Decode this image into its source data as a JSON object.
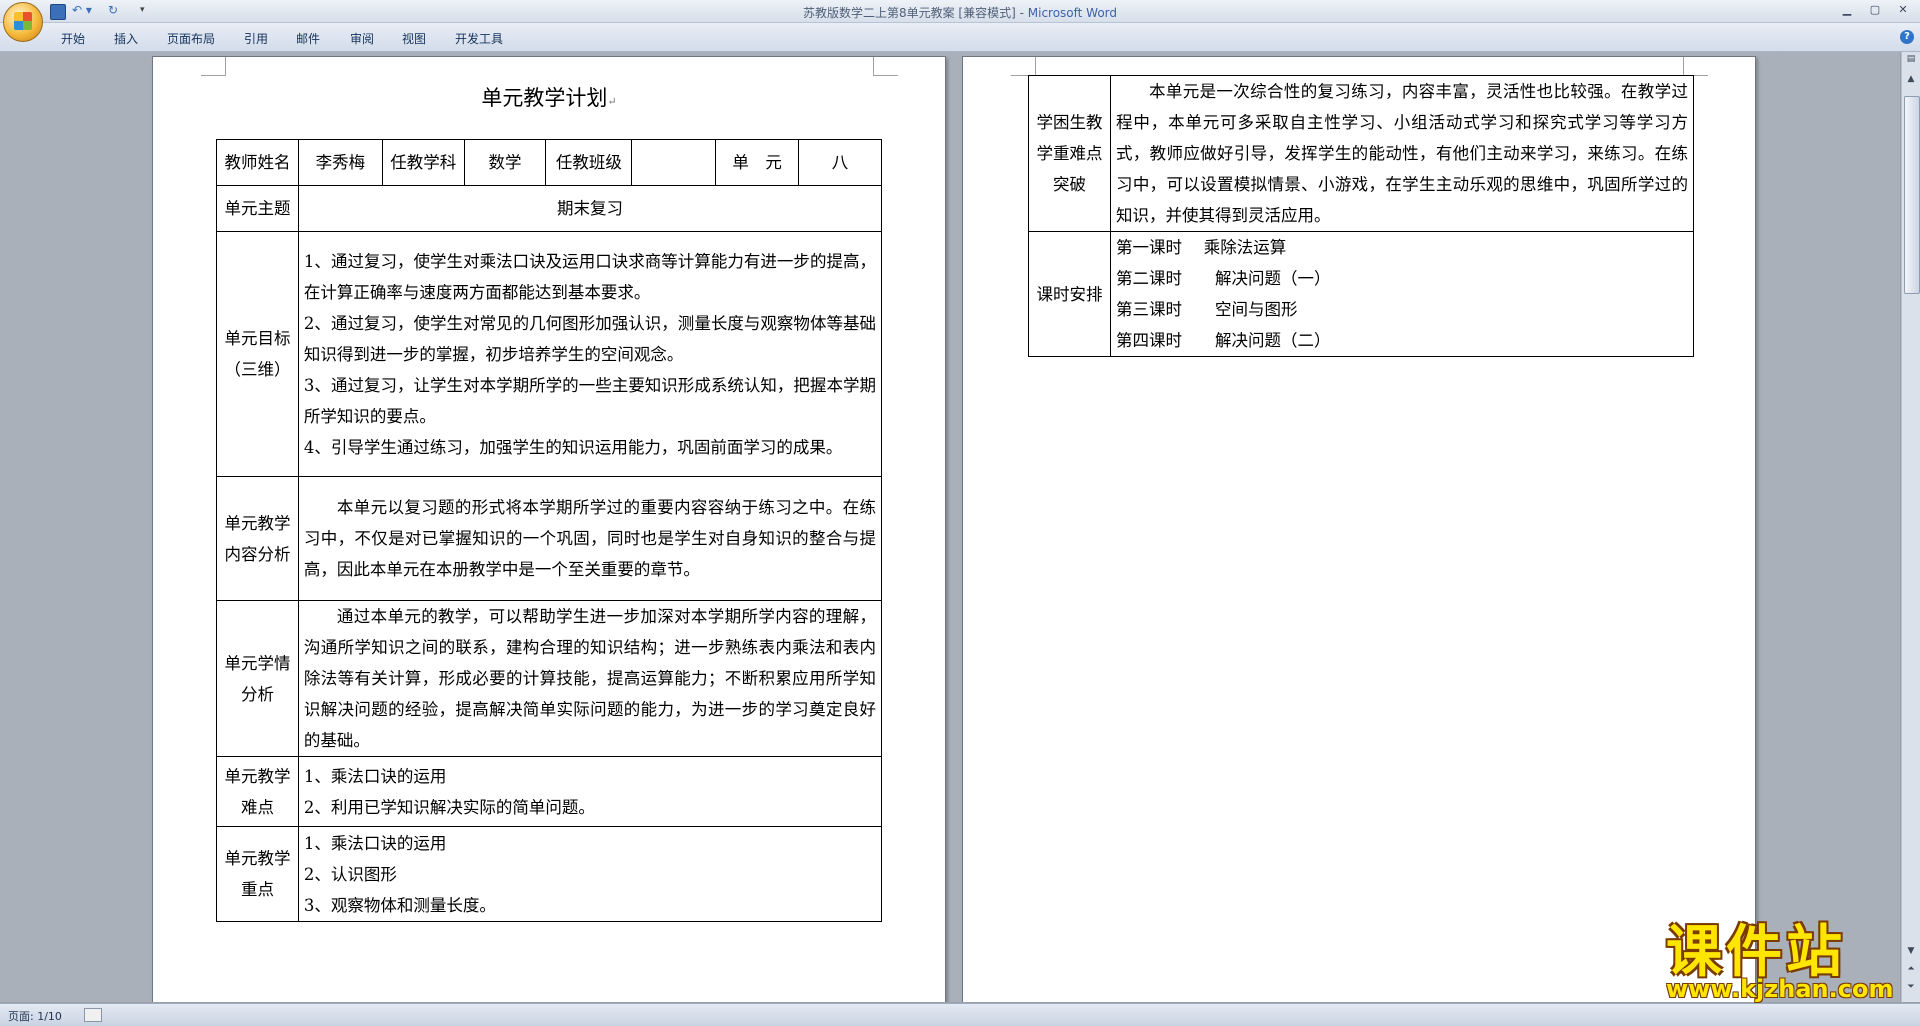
{
  "window": {
    "doc_title": "苏教版数学二上第8单元教案 [兼容模式]",
    "separator": " - ",
    "app_name": "Microsoft Word"
  },
  "ribbon_tabs": [
    "开始",
    "插入",
    "页面布局",
    "引用",
    "邮件",
    "审阅",
    "视图",
    "开发工具"
  ],
  "status": {
    "page": "页面: 1/10"
  },
  "document": {
    "title": "单元教学计划",
    "header_row": {
      "teacher_label": "教师姓名",
      "teacher_name": "李秀梅",
      "subject_label": "任教学科",
      "subject": "数学",
      "class_label": "任教班级",
      "class": "",
      "unit_label": "单　元",
      "unit": "八"
    },
    "rows": {
      "theme": {
        "label": "单元主题",
        "text": "期末复习"
      },
      "goals": {
        "label": "单元目标（三维）",
        "items": [
          "1、通过复习，使学生对乘法口诀及运用口诀求商等计算能力有进一步的提高，在计算正确率与速度两方面都能达到基本要求。",
          "2、通过复习，使学生对常见的几何图形加强认识，测量长度与观察物体等基础知识得到进一步的掌握，初步培养学生的空间观念。",
          "3、通过复习，让学生对本学期所学的一些主要知识形成系统认知，把握本学期所学知识的要点。",
          "4、引导学生通过练习，加强学生的知识运用能力，巩固前面学习的成果。"
        ]
      },
      "content": {
        "label": "单元教学内容分析",
        "text": "本单元以复习题的形式将本学期所学过的重要内容容纳于练习之中。在练习中，不仅是对已掌握知识的一个巩固，同时也是学生对自身知识的整合与提高，因此本单元在本册教学中是一个至关重要的章节。"
      },
      "students": {
        "label": "单元学情分析",
        "text": "通过本单元的教学，可以帮助学生进一步加深对本学期所学内容的理解，沟通所学知识之间的联系，建构合理的知识结构；进一步熟练表内乘法和表内除法等有关计算，形成必要的计算技能，提高运算能力；不断积累应用所学知识解决问题的经验，提高解决简单实际问题的能力，为进一步的学习奠定良好的基础。"
      },
      "difficulties": {
        "label": "单元教学难点",
        "items": [
          "1、乘法口诀的运用",
          "2、利用已学知识解决实际的简单问题。"
        ]
      },
      "key_points": {
        "label": "单元教学重点",
        "items": [
          "1、乘法口诀的运用",
          "2、认识图形",
          "3、观察物体和测量长度。"
        ]
      }
    },
    "page2": {
      "breakthrough": {
        "label": "学困生教学重难点突破",
        "text": "本单元是一次综合性的复习练习，内容丰富，灵活性也比较强。在教学过程中，本单元可多采取自主性学习、小组活动式学习和探究式学习等学习方式，教师应做好引导，发挥学生的能动性，有他们主动来学习，来练习。在练习中，可以设置模拟情景、小游戏，在学生主动乐观的思维中，巩固所学过的知识，并使其得到灵活应用。"
      },
      "schedule": {
        "label": "课时安排",
        "items": [
          {
            "period": "第一课时",
            "topic": "乘除法运算"
          },
          {
            "period": "第二课时",
            "topic": "解决问题（一）"
          },
          {
            "period": "第三课时",
            "topic": "空间与图形"
          },
          {
            "period": "第四课时",
            "topic": "解决问题（二）"
          }
        ]
      }
    }
  },
  "watermark": {
    "name": "课件站",
    "url": "www.kjzhan.com"
  }
}
